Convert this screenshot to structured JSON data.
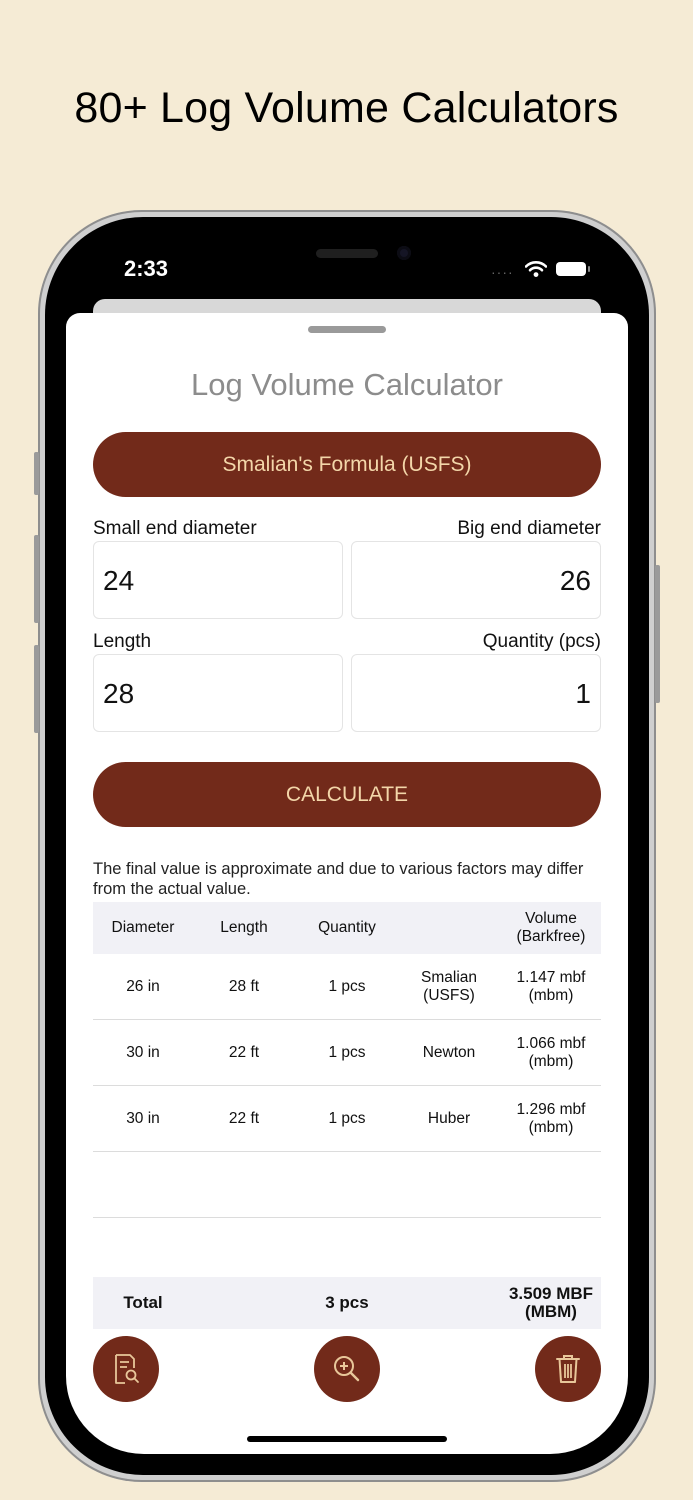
{
  "promo_title": "80+ Log Volume Calculators",
  "status": {
    "time": "2:33",
    "signal": "····"
  },
  "app": {
    "title": "Log Volume Calculator",
    "formula_button": "Smalian's Formula (USFS)",
    "fields": {
      "small_end": {
        "label": "Small end diameter",
        "value": "24"
      },
      "big_end": {
        "label": "Big end diameter",
        "value": "26"
      },
      "length": {
        "label": "Length",
        "value": "28"
      },
      "quantity": {
        "label": "Quantity (pcs)",
        "value": "1"
      }
    },
    "calculate_button": "CALCULATE",
    "note": "The final value is approximate and due to various factors may differ from the actual value.",
    "table": {
      "headers": [
        "Diameter",
        "Length",
        "Quantity",
        "",
        "Volume (Barkfree)"
      ],
      "rows": [
        [
          "26 in",
          "28 ft",
          "1 pcs",
          "Smalian (USFS)",
          "1.147 mbf (mbm)"
        ],
        [
          "30 in",
          "22 ft",
          "1 pcs",
          "Newton",
          "1.066 mbf (mbm)"
        ],
        [
          "30 in",
          "22 ft",
          "1 pcs",
          "Huber",
          "1.296 mbf (mbm)"
        ]
      ],
      "total": {
        "label": "Total",
        "quantity": "3 pcs",
        "volume": "3.509 MBF (MBM)"
      }
    }
  },
  "icons": {
    "report": "report-search-icon",
    "zoom": "zoom-in-icon",
    "trash": "trash-icon"
  },
  "colors": {
    "accent": "#722a1a",
    "accent_text": "#f3d6a9",
    "background": "#f5ebd5"
  }
}
